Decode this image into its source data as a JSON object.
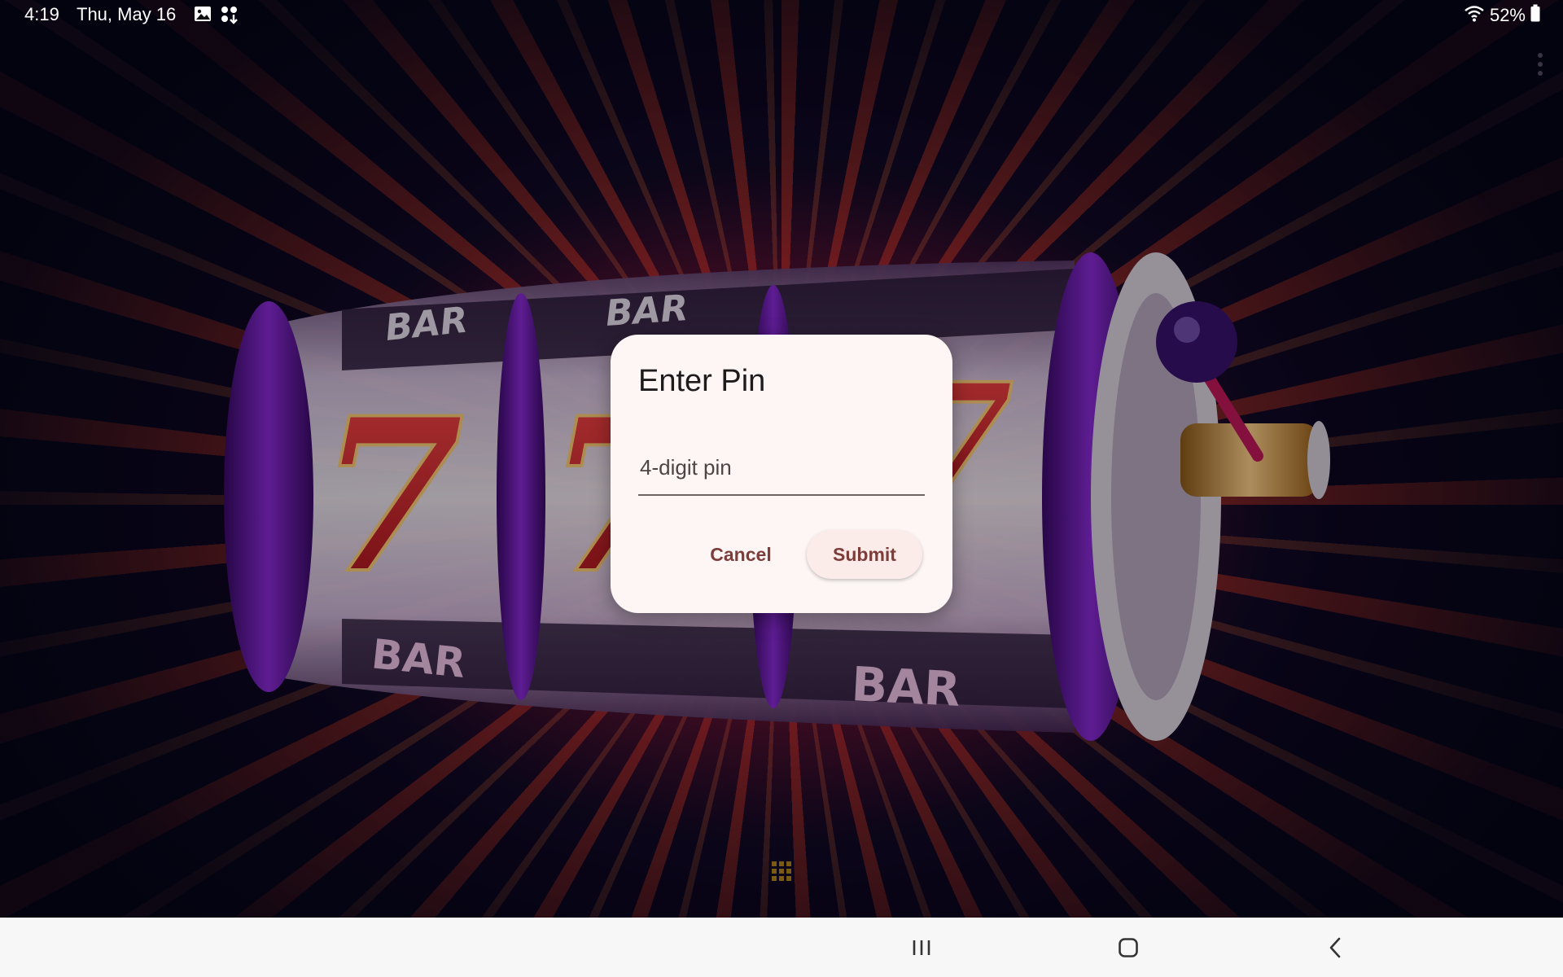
{
  "status_bar": {
    "time": "4:19",
    "date": "Thu, May 16",
    "battery": "52%",
    "icons": [
      "gallery-icon",
      "apps-notification-icon",
      "wifi-icon",
      "battery-icon"
    ]
  },
  "dialog": {
    "title": "Enter Pin",
    "pin_placeholder": "4-digit pin",
    "pin_value": "",
    "cancel_label": "Cancel",
    "submit_label": "Submit"
  },
  "background": {
    "reel_labels": [
      "BAR",
      "BAR",
      "BAR",
      "BAR",
      "7",
      "7",
      "7"
    ]
  },
  "nav_bar": {
    "buttons": [
      "recents-icon",
      "home-icon",
      "back-icon"
    ]
  },
  "colors": {
    "dialog_bg": "#fdf6f4",
    "accent": "#7d3d3a",
    "submit_bg": "#fbecea",
    "nav_bg": "#f8f7f7"
  }
}
